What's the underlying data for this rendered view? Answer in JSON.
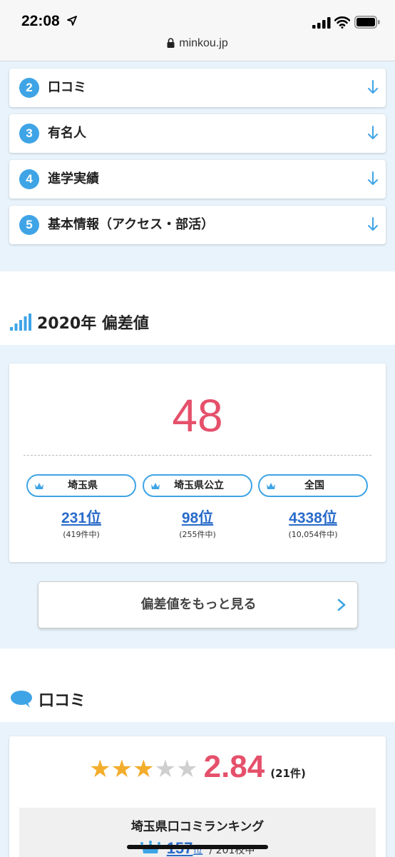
{
  "status_bar": {
    "time": "22:08",
    "url": "minkou.jp",
    "icons": [
      "location-arrow-icon",
      "signal-icon",
      "wifi-icon",
      "battery-icon",
      "lock-icon"
    ]
  },
  "toc": {
    "items": [
      {
        "num": "2",
        "label": "口コミ"
      },
      {
        "num": "3",
        "label": "有名人"
      },
      {
        "num": "4",
        "label": "進学実績"
      },
      {
        "num": "5",
        "label": "基本情報（アクセス・部活）"
      }
    ]
  },
  "hensachi": {
    "heading": "2020年 偏差値",
    "value": "48",
    "ranks": [
      {
        "label": "埼玉県",
        "rank": "231位",
        "sub": "(419件中)"
      },
      {
        "label": "埼玉県公立",
        "rank": "98位",
        "sub": "(255件中)"
      },
      {
        "label": "全国",
        "rank": "4338位",
        "sub": "(10,054件中)"
      }
    ],
    "more_button": "偏差値をもっと見る"
  },
  "reviews": {
    "heading": "口コミ",
    "stars_on": 3,
    "stars_total": 5,
    "score": "2.84",
    "count": "(21件)",
    "ranking_title": "埼玉県口コミランキング",
    "ranking_value": "157",
    "ranking_unit": "位",
    "ranking_total": "/ 201校中"
  },
  "colors": {
    "accent_blue": "#3fa4e6",
    "score_pink": "#e5506b",
    "link_blue": "#2a6bc9",
    "section_bg": "#e8f3fb",
    "star_gold": "#f3ad2c"
  }
}
